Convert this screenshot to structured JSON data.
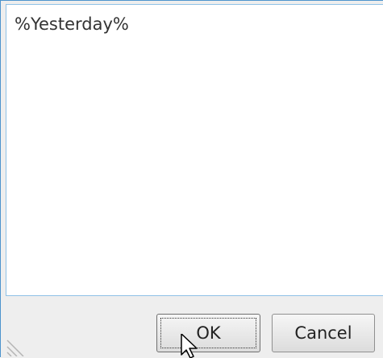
{
  "editor": {
    "text": "%Yesterday%"
  },
  "buttons": {
    "ok_label": "OK",
    "cancel_label": "Cancel"
  },
  "colors": {
    "dialog_border": "#4d94cd",
    "text_area_border": "#8fc1e6",
    "dialog_background": "#eeeeee"
  },
  "icons": {
    "resize_grip": "resize-grip-icon",
    "cursor": "mouse-pointer-icon"
  }
}
